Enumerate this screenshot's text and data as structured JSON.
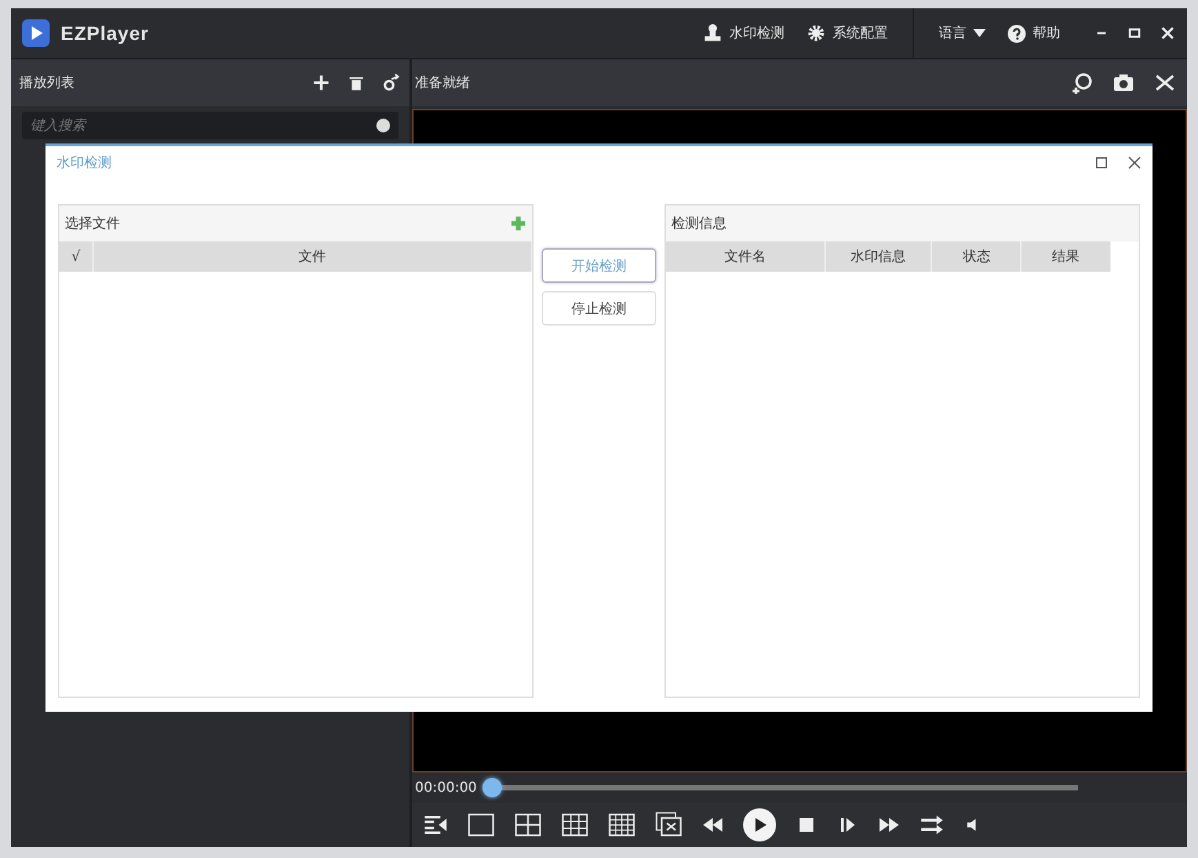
{
  "window": {
    "title": "EZPlayer"
  },
  "toolbar": [
    {
      "kind": "watermark",
      "label": "水印检测"
    },
    {
      "kind": "settings",
      "label": "系统配置"
    }
  ],
  "language": {
    "label": "语言"
  },
  "help": {
    "label": "帮助"
  },
  "playlist": {
    "title": "播放列表",
    "search": {
      "placeholder": "键入搜索"
    }
  },
  "status": "准备就绪",
  "progress": {
    "time": "00:00:00",
    "level": 0
  },
  "dialog": {
    "title": "水印检测",
    "files": {
      "title": "选择文件",
      "columns": [
        "√",
        "文件"
      ]
    },
    "actions": [
      {
        "label": "开始检测",
        "selected": true
      },
      {
        "label": "停止检测",
        "selected": false
      }
    ],
    "info": {
      "title": "检测信息",
      "columns": [
        "文件名",
        "水印信息",
        "状态",
        "结果"
      ]
    }
  }
}
